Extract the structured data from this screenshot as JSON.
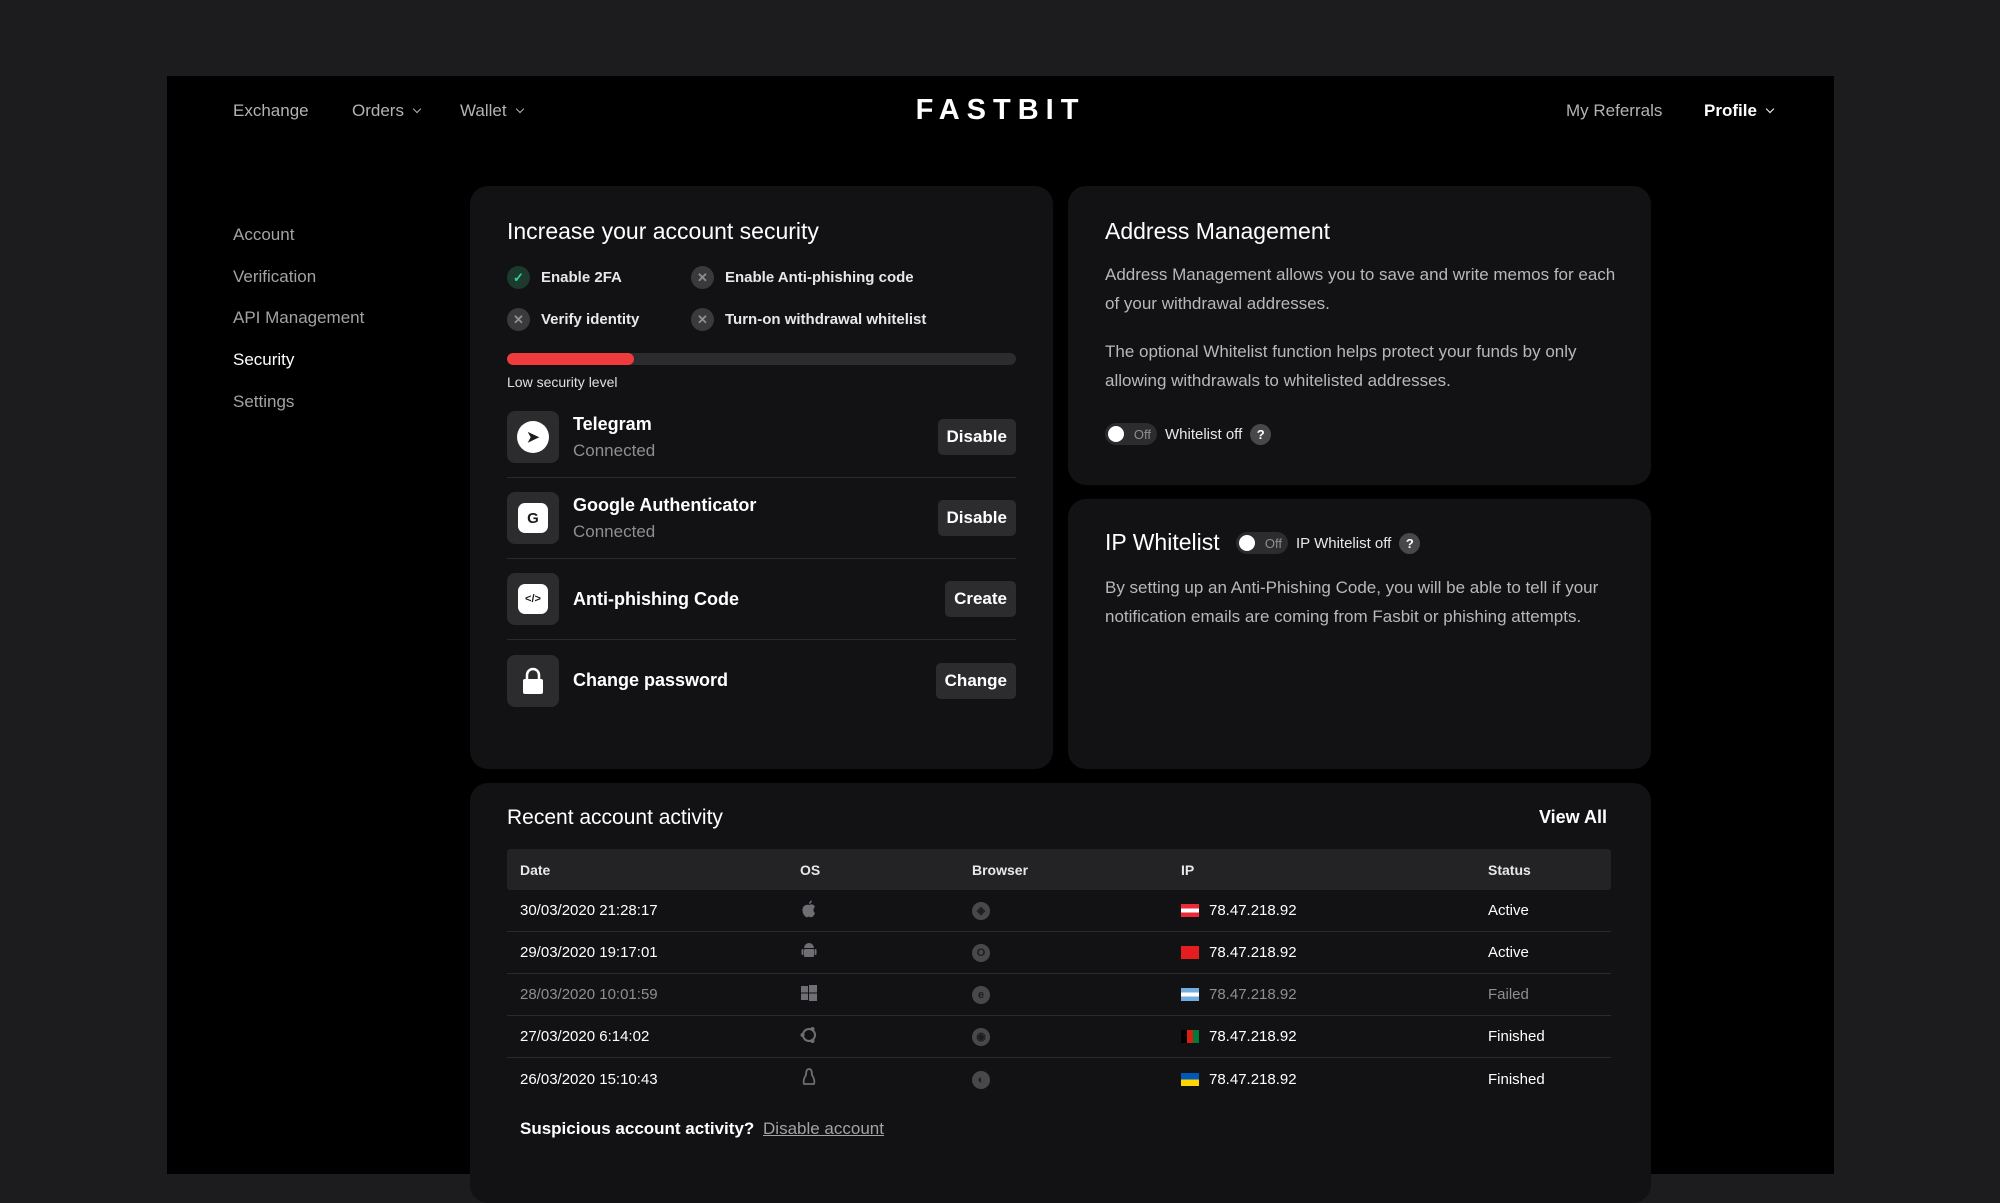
{
  "nav": {
    "left": [
      "Exchange",
      "Orders",
      "Wallet"
    ],
    "logo": "FASTBIT",
    "referrals": "My Referrals",
    "profile": "Profile"
  },
  "sidebar": [
    "Account",
    "Verification",
    "API Management",
    "Security",
    "Settings"
  ],
  "security": {
    "title": "Increase your account security",
    "checks": [
      {
        "label": "Enable 2FA",
        "done": true
      },
      {
        "label": "Enable Anti-phishing code",
        "done": false
      },
      {
        "label": "Verify identity",
        "done": false
      },
      {
        "label": "Turn-on withdrawal whitelist",
        "done": false
      }
    ],
    "progress_fraction": 0.25,
    "level_label": "Low security level",
    "methods": [
      {
        "title": "Telegram",
        "status": "Connected",
        "button": "Disable",
        "icon": "telegram-icon"
      },
      {
        "title": "Google Authenticator",
        "status": "Connected",
        "button": "Disable",
        "icon": "google-icon"
      },
      {
        "title": "Anti-phishing Code",
        "status": "",
        "button": "Create",
        "icon": "code-icon"
      },
      {
        "title": "Change password",
        "status": "",
        "button": "Change",
        "icon": "lock-icon"
      }
    ]
  },
  "address": {
    "title": "Address Management",
    "p1": "Address Management allows you to save and write memos for each of your withdrawal addresses.",
    "p2": "The optional Whitelist function helps protect your funds by only allowing withdrawals to whitelisted addresses.",
    "switch_label": "Off",
    "toggle_label": "Whitelist off",
    "help": "?"
  },
  "ip": {
    "title": "IP Whitelist",
    "switch_label": "Off",
    "toggle_label": "IP Whitelist off",
    "help": "?",
    "text": "By setting up an Anti-Phishing Code, you will be able to tell if your notification emails are coming from Fasbit or phishing attempts."
  },
  "activity": {
    "title": "Recent account activity",
    "view_all": "View All",
    "columns": [
      "Date",
      "OS",
      "Browser",
      "IP",
      "Status"
    ],
    "rows": [
      {
        "date": "30/03/2020 21:28:17",
        "os": "apple-icon",
        "browser": "safari-icon",
        "flag": "austria-flag",
        "ip": "78.47.218.92",
        "status": "Active",
        "dim": false
      },
      {
        "date": "29/03/2020 19:17:01",
        "os": "android-icon",
        "browser": "opera-icon",
        "flag": "albania-flag",
        "ip": "78.47.218.92",
        "status": "Active",
        "dim": false
      },
      {
        "date": "28/03/2020 10:01:59",
        "os": "windows-icon",
        "browser": "ie-icon",
        "flag": "argentina-flag",
        "ip": "78.47.218.92",
        "status": "Failed",
        "dim": true
      },
      {
        "date": "27/03/2020 6:14:02",
        "os": "ubuntu-icon",
        "browser": "chrome-icon",
        "flag": "afghanistan-flag",
        "ip": "78.47.218.92",
        "status": "Finished",
        "dim": false
      },
      {
        "date": "26/03/2020 15:10:43",
        "os": "linux-icon",
        "browser": "firefox-icon",
        "flag": "ukraine-flag",
        "ip": "78.47.218.92",
        "status": "Finished",
        "dim": false
      }
    ],
    "suspicious_label": "Suspicious account activity?",
    "disable_link": "Disable account"
  }
}
